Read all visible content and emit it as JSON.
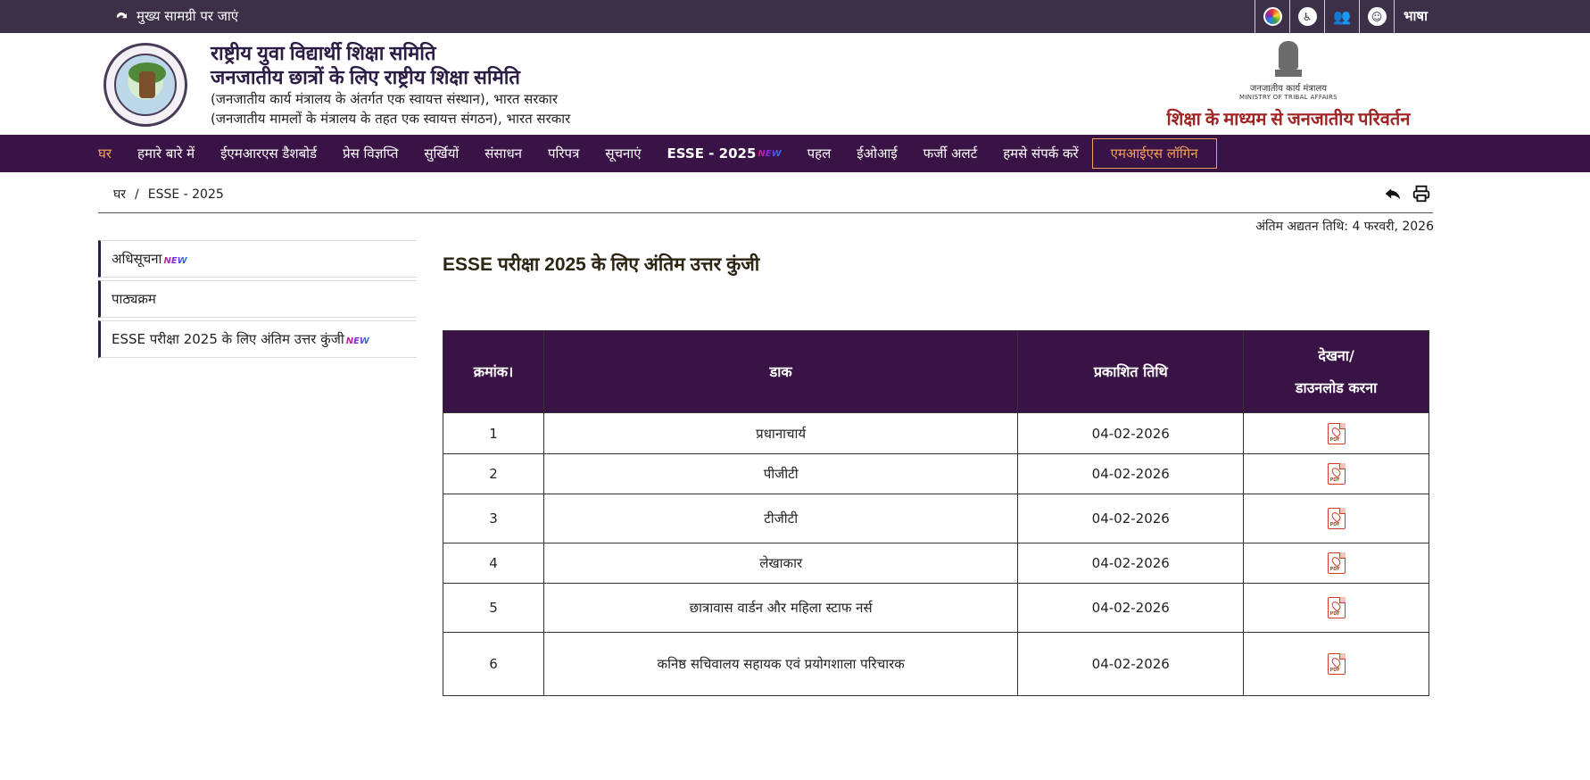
{
  "topbar": {
    "skip_label": "मुख्य सामग्री पर जाएं",
    "language_label": "भाषा",
    "tools": [
      "color-contrast-icon",
      "accessibility-icon",
      "sitemap-icon",
      "screen-reader-icon"
    ]
  },
  "header": {
    "org_title_1": "राष्ट्रीय युवा विद्यार्थी शिक्षा समिति",
    "org_title_2": "जनजातीय छात्रों के लिए राष्ट्रीय शिक्षा समिति",
    "org_sub_1": "(जनजातीय कार्य मंत्रालय के अंतर्गत एक स्वायत्त संस्थान), भारत सरकार",
    "org_sub_2": "(जनजातीय मामलों के मंत्रालय के तहत एक स्वायत्त संगठन), भारत सरकार",
    "ministry_hi": "जनजातीय कार्य मंत्रालय",
    "ministry_en": "MINISTRY OF TRIBAL AFFAIRS",
    "tagline": "शिक्षा के माध्यम से जनजातीय परिवर्तन"
  },
  "nav": {
    "items": [
      "घर",
      "हमारे बारे में",
      "ईएमआरएस डैशबोर्ड",
      "प्रेस विज्ञप्ति",
      "सुर्खियों",
      "संसाधन",
      "परिपत्र",
      "सूचनाएं",
      "ESSE - 2025",
      "पहल",
      "ईओआई",
      "फर्जी अलर्ट",
      "हमसे संपर्क करें"
    ],
    "new_tag": "NEW",
    "login_label": "एमआईएस लॉगिन"
  },
  "breadcrumb": {
    "home": "घर",
    "separator": "/",
    "current": "ESSE - 2025"
  },
  "last_updated": "अंतिम अद्यतन तिथि: 4 फरवरी, 2026",
  "sidebar": {
    "items": [
      {
        "label": "अधिसूचना",
        "is_new": true
      },
      {
        "label": "पाठ्यक्रम",
        "is_new": false
      },
      {
        "label": "ESSE परीक्षा 2025 के लिए अंतिम उत्तर कुंजी",
        "is_new": true
      }
    ],
    "new_tag": "NEW"
  },
  "main": {
    "title": "ESSE परीक्षा 2025 के लिए अंतिम उत्तर कुंजी",
    "table": {
      "headers": [
        "क्रमांक।",
        "डाक",
        "प्रकाशित तिथि",
        "देखना/",
        "डाउनलोड करना"
      ],
      "rows": [
        {
          "sno": "1",
          "post": "प्रधानाचार्य",
          "date": "04-02-2026"
        },
        {
          "sno": "2",
          "post": "पीजीटी",
          "date": "04-02-2026"
        },
        {
          "sno": "3",
          "post": "टीजीटी",
          "date": "04-02-2026"
        },
        {
          "sno": "4",
          "post": "लेखाकार",
          "date": "04-02-2026"
        },
        {
          "sno": "5",
          "post": "छात्रावास वार्डन और महिला स्टाफ नर्स",
          "date": "04-02-2026"
        },
        {
          "sno": "6",
          "post": "कनिष्ठ सचिवालय सहायक एवं प्रयोगशाला परिचारक",
          "date": "04-02-2026"
        }
      ],
      "pdf_label": "PDF"
    }
  }
}
